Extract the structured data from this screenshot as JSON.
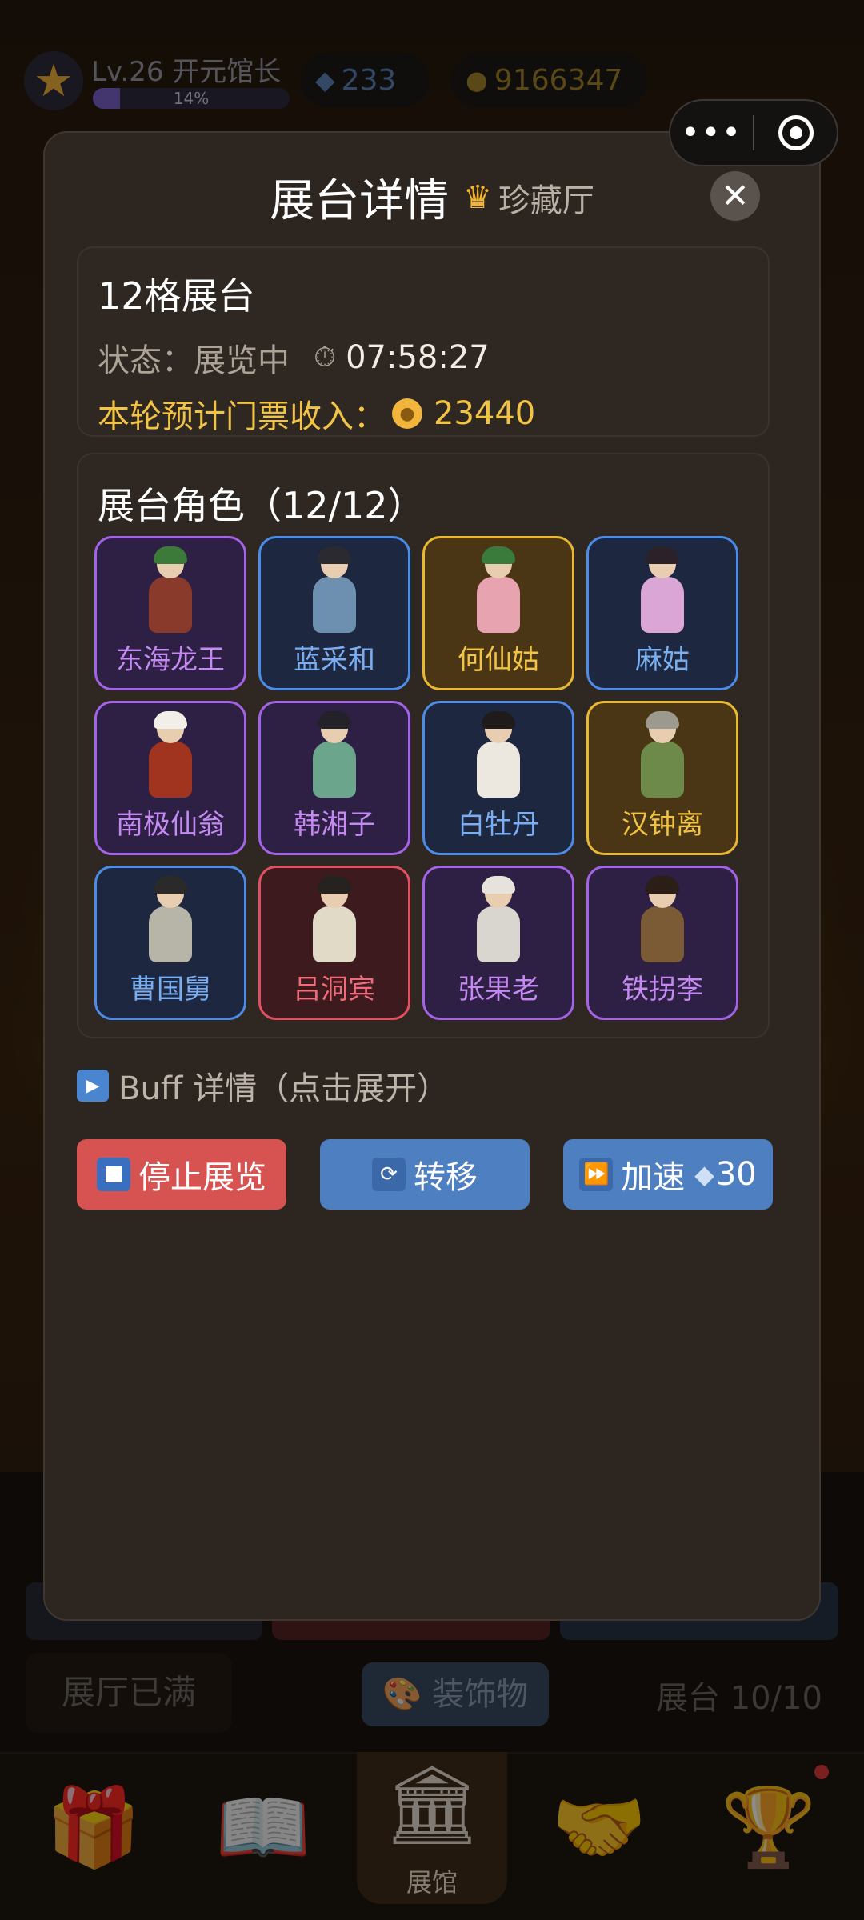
{
  "topbar": {
    "level": "Lv.26 开元馆长",
    "xp_percent": 14,
    "xp_label": "14%",
    "gems": "233",
    "coins": "9166347"
  },
  "background": {
    "hall_full_label": "展厅已满",
    "decorations_label": "装饰物",
    "slots_label": "展台 10/10"
  },
  "modal": {
    "title": "展台详情",
    "subtitle": "珍藏厅",
    "info": {
      "name": "12格展台",
      "status_label": "状态：",
      "status_value": "展览中",
      "timer": "07:58:27",
      "income_label": "本轮预计门票收入：",
      "income_value": "23440"
    },
    "roles_title": "展台角色（12/12）",
    "roles": [
      {
        "name": "东海龙王",
        "rarity": "purple",
        "body": "#8a3a2a",
        "hair": "#3c7a3a"
      },
      {
        "name": "蓝采和",
        "rarity": "blue",
        "body": "#6d8fb0",
        "hair": "#2a2a30"
      },
      {
        "name": "何仙姑",
        "rarity": "gold",
        "body": "#e8a3b0",
        "hair": "#3a7a3a"
      },
      {
        "name": "麻姑",
        "rarity": "blue",
        "body": "#d9a6d6",
        "hair": "#2a2228"
      },
      {
        "name": "南极仙翁",
        "rarity": "purple",
        "body": "#a0341f",
        "hair": "#f1efe8"
      },
      {
        "name": "韩湘子",
        "rarity": "purple",
        "body": "#6aa58c",
        "hair": "#222228"
      },
      {
        "name": "白牡丹",
        "rarity": "blue",
        "body": "#ece8e0",
        "hair": "#1f1b1b"
      },
      {
        "name": "汉钟离",
        "rarity": "gold",
        "body": "#6e8a4a",
        "hair": "#9c9a8e"
      },
      {
        "name": "曹国舅",
        "rarity": "blue",
        "body": "#b7b4a8",
        "hair": "#2a2a2a"
      },
      {
        "name": "吕洞宾",
        "rarity": "red",
        "body": "#e0dac6",
        "hair": "#262220"
      },
      {
        "name": "张果老",
        "rarity": "purple",
        "body": "#d9d6d0",
        "hair": "#e6e3dc"
      },
      {
        "name": "铁拐李",
        "rarity": "purple",
        "body": "#7b5a36",
        "hair": "#2a1e16"
      }
    ],
    "buff_label": "Buff 详情（点击展开）",
    "buttons": {
      "stop": "停止展览",
      "move": "转移",
      "speed": "加速",
      "speed_cost": "30"
    }
  },
  "nav": {
    "items": [
      {
        "icon": "gift-icon"
      },
      {
        "icon": "book-icon"
      },
      {
        "icon": "museum-icon",
        "label": "展馆",
        "active": true
      },
      {
        "icon": "handshake-icon"
      },
      {
        "icon": "trophy-icon",
        "badge": true
      }
    ],
    "active_label": "展馆"
  },
  "colors": {
    "purple": "#a463e6",
    "blue": "#4c8ce6",
    "gold": "#e8b830",
    "red": "#e05060",
    "stop_button": "#d65352",
    "action_button": "#4e7fc0"
  }
}
